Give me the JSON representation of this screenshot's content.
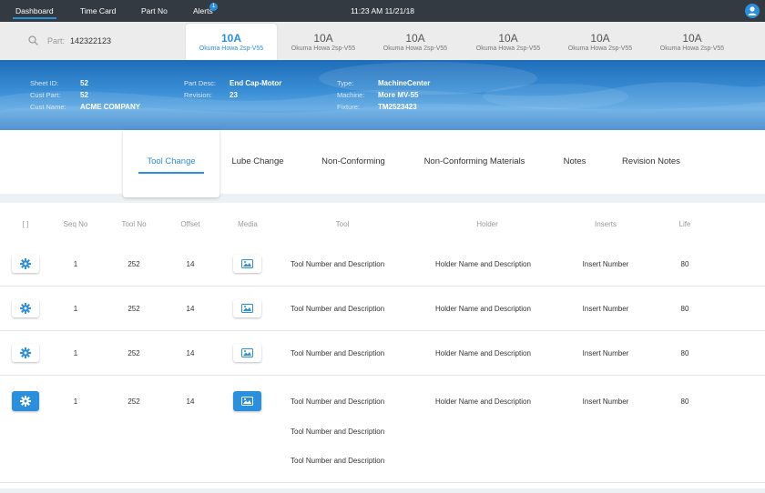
{
  "nav": {
    "items": [
      {
        "label": "Dashboard",
        "active": true
      },
      {
        "label": "Time Card"
      },
      {
        "label": "Part No"
      },
      {
        "label": "Alerts"
      }
    ],
    "alerts_count": "1",
    "clock": "11:23 AM 11/21/18"
  },
  "search": {
    "label": "Part:",
    "value": "142322123"
  },
  "machines": [
    {
      "code": "10A",
      "model": "Okuma Howa 2sp-V55",
      "active": true
    },
    {
      "code": "10A",
      "model": "Okuma Howa 2sp-V55"
    },
    {
      "code": "10A",
      "model": "Okuma Howa 2sp-V55"
    },
    {
      "code": "10A",
      "model": "Okuma Howa 2sp-V55"
    },
    {
      "code": "10A",
      "model": "Okuma Howa 2sp-V55"
    },
    {
      "code": "10A",
      "model": "Okuma Howa 2sp-V55"
    }
  ],
  "info": {
    "sheet_id_label": "Sheet ID:",
    "sheet_id": "52",
    "cust_part_label": "Cust Part:",
    "cust_part": "52",
    "cust_name_label": "Cust Name:",
    "cust_name": "ACME COMPANY",
    "part_desc_label": "Part Desc:",
    "part_desc": "End Cap-Motor",
    "revision_label": "Revision:",
    "revision": "23",
    "type_label": "Type:",
    "type": "MachineCenter",
    "machine_label": "Machine:",
    "machine": "More MV-55",
    "fixture_label": "Fixture:",
    "fixture": "TM2523423"
  },
  "section_tabs": [
    {
      "label": "Tool Change",
      "active": true
    },
    {
      "label": "Lube Change"
    },
    {
      "label": "Non-Conforming"
    },
    {
      "label": "Non-Conforming Materials"
    },
    {
      "label": "Notes"
    },
    {
      "label": "Revision Notes"
    }
  ],
  "table": {
    "headers": {
      "select": "[ ]",
      "seq": "Seq No",
      "tool_no": "Tool No",
      "offset": "Offset",
      "media": "Media",
      "tool": "Tool",
      "holder": "Holder",
      "inserts": "Inserts",
      "life": "Life"
    },
    "rows": [
      {
        "seq": "1",
        "tool_no": "252",
        "offset": "14",
        "tool": "Tool Number and Description",
        "holder": "Holder Name and Description",
        "inserts": "Insert Number",
        "life": "80",
        "active": false
      },
      {
        "seq": "1",
        "tool_no": "252",
        "offset": "14",
        "tool": "Tool Number and Description",
        "holder": "Holder Name and Description",
        "inserts": "Insert Number",
        "life": "80",
        "active": false
      },
      {
        "seq": "1",
        "tool_no": "252",
        "offset": "14",
        "tool": "Tool Number and Description",
        "holder": "Holder Name and Description",
        "inserts": "Insert Number",
        "life": "80",
        "active": false
      },
      {
        "seq": "1",
        "tool_no": "252",
        "offset": "14",
        "tool": "Tool Number and Description",
        "holder": "Holder Name and Description",
        "inserts": "Insert Number",
        "life": "80",
        "active": true,
        "extra_tools": [
          "Tool Number and Description",
          "Tool Number and Description"
        ]
      }
    ]
  },
  "colors": {
    "accent": "#2a8fdc",
    "nav_bg": "#333a42",
    "banner": "#2f7dc8"
  }
}
